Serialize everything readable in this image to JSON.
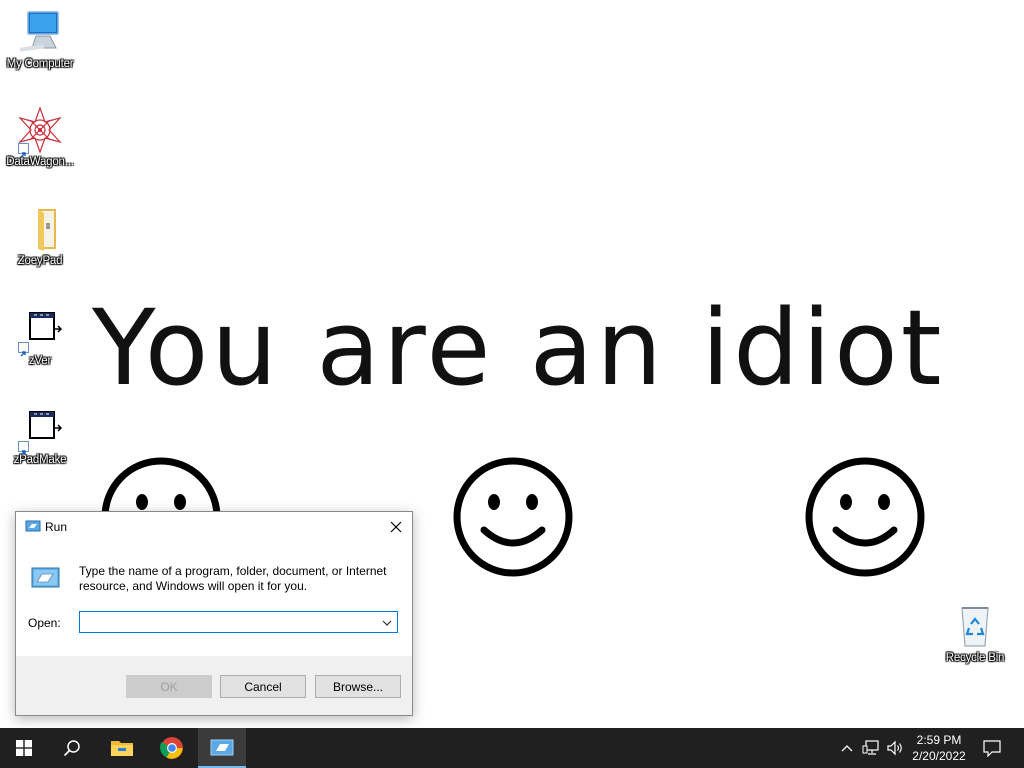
{
  "desktop": {
    "icons": [
      {
        "label": "My Computer",
        "icon": "computer-icon"
      },
      {
        "label": "DataWagon...",
        "icon": "datawagon-icon"
      },
      {
        "label": "ZoeyPad",
        "icon": "folder-icon"
      },
      {
        "label": "zVer",
        "icon": "app-shortcut-icon"
      },
      {
        "label": "zPadMake",
        "icon": "app-shortcut-icon"
      },
      {
        "label": "Recycle Bin",
        "icon": "recycle-bin-icon"
      }
    ],
    "wallpaper_text": "You are an idiot"
  },
  "run_dialog": {
    "title": "Run",
    "description": "Type the name of a program, folder, document, or Internet resource, and Windows will open it for you.",
    "open_label": "Open:",
    "open_value": "",
    "ok_label": "OK",
    "cancel_label": "Cancel",
    "browse_label": "Browse...",
    "accent_color": "#0078d7"
  },
  "taskbar": {
    "pinned": [
      "start-icon",
      "search-icon",
      "file-explorer-icon",
      "chrome-icon",
      "run-icon"
    ],
    "active_app": "run-icon",
    "clock": {
      "time": "2:59 PM",
      "date": "2/20/2022"
    }
  }
}
